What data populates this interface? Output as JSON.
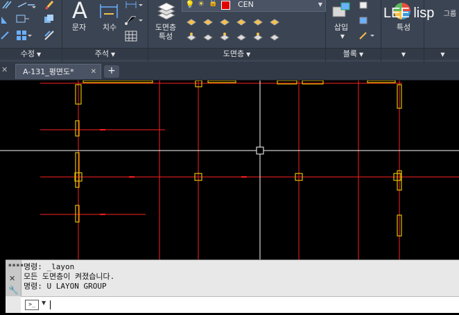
{
  "ribbon": {
    "panels": {
      "modify": {
        "title": "수정"
      },
      "annotation": {
        "title": "주석",
        "text_label": "문자",
        "dim_label": "치수"
      },
      "layers": {
        "title": "도면층",
        "properties_label": "도면층\n특성",
        "current_layer": "CEN"
      },
      "block": {
        "title": "블록",
        "insert_label": "삽입"
      },
      "properties": {
        "label": "특성"
      },
      "groups": {
        "label": "그룹"
      }
    },
    "overlay_text": "LEE lisp"
  },
  "tabs": {
    "active": "A-131_평면도*",
    "new_tab": "+"
  },
  "command": {
    "history": [
      "명령: _layon",
      "모든 도면층이 켜졌습니다.",
      "명령: U LAYON GROUP"
    ],
    "input_value": "",
    "prompt_icon": ">_"
  },
  "colors": {
    "ribbon_bg": "#3b4453",
    "grid_line": "#ff1f1f",
    "column": "#e0c000",
    "crosshair": "#ffffff",
    "layer_swatch": "#e00000"
  }
}
